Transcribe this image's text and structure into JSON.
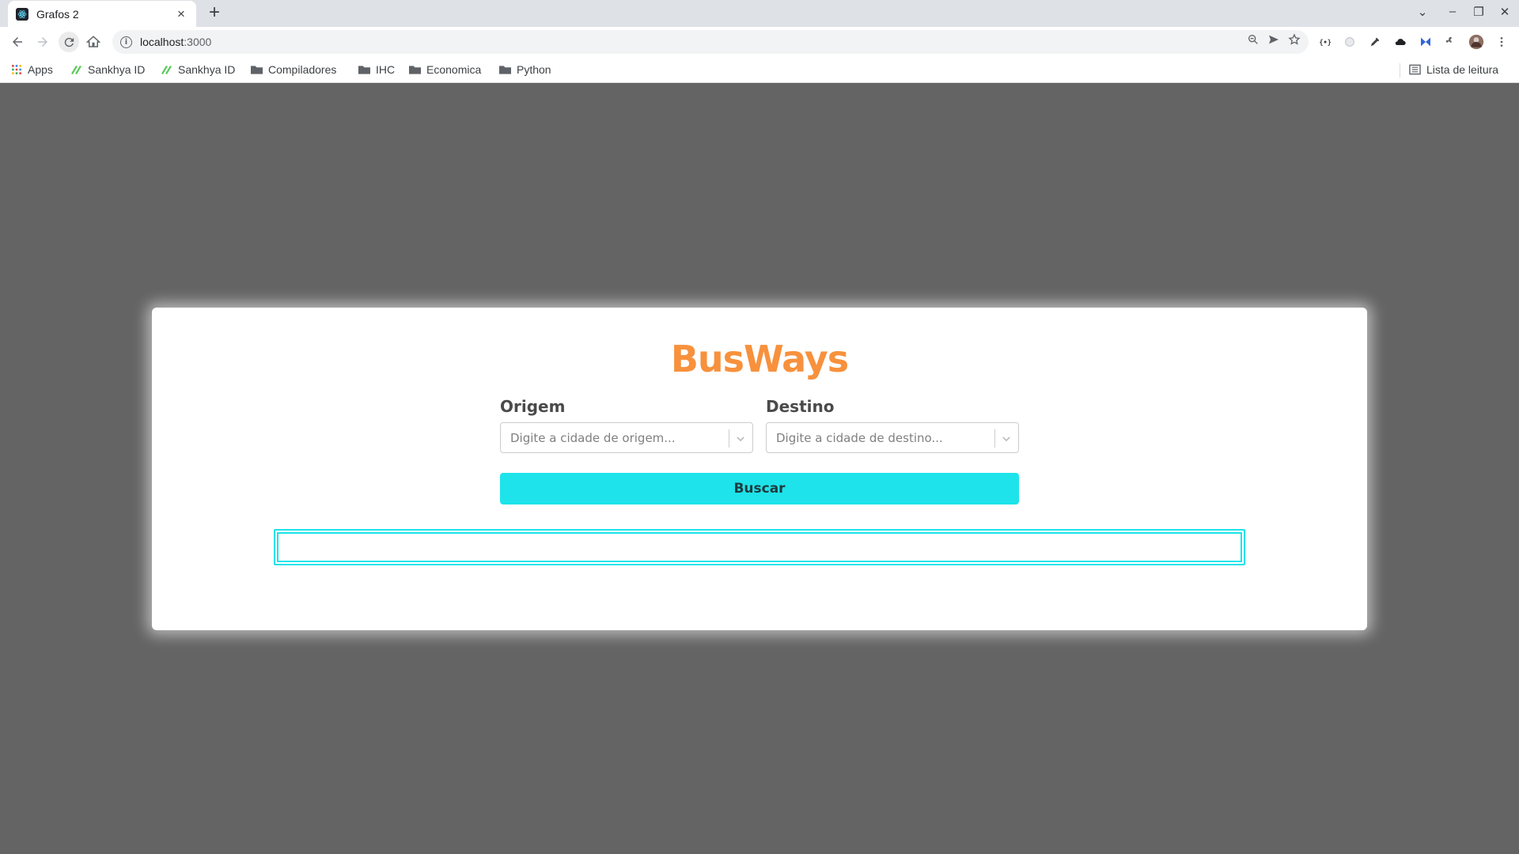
{
  "browser": {
    "tab_title": "Grafos 2",
    "tab_close": "×",
    "new_tab": "+",
    "url_host": "localhost",
    "url_port": ":3000",
    "window_controls": [
      "⌄",
      "–",
      "❐",
      "✕"
    ]
  },
  "bookmarks": {
    "items": [
      {
        "label": "Apps",
        "icon": "apps-grid-icon"
      },
      {
        "label": "Sankhya ID",
        "icon": "sankhya-icon"
      },
      {
        "label": "Sankhya ID",
        "icon": "sankhya-icon"
      },
      {
        "label": "Compiladores",
        "icon": "folder-icon"
      },
      {
        "label": "IHC",
        "icon": "folder-icon"
      },
      {
        "label": "Economica",
        "icon": "folder-icon"
      },
      {
        "label": "Python",
        "icon": "folder-icon"
      }
    ],
    "reading_list": "Lista de leitura"
  },
  "app": {
    "logo": "BusWays",
    "origin_label": "Origem",
    "origin_placeholder": "Digite a cidade de origem...",
    "destination_label": "Destino",
    "destination_placeholder": "Digite a cidade de destino...",
    "search_button": "Buscar"
  },
  "colors": {
    "page_background": "#646464",
    "logo": "#f7913d",
    "accent": "#1ee3ea"
  }
}
